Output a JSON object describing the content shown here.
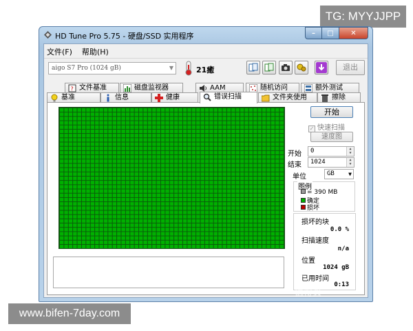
{
  "overlay": {
    "tg_label": "TG: MYYJJPP",
    "site_label": "www.bifen-7day.com",
    "faint_mark": "值得买"
  },
  "window": {
    "title": "HD Tune Pro 5.75 - 硬盘/SSD 实用程序",
    "buttons": {
      "minimize": "–",
      "maximize": "□",
      "close": "✕"
    }
  },
  "menu": {
    "file": "文件(F)",
    "help": "帮助(H)"
  },
  "toolbar": {
    "drive": "aigo    S7 Pro (1024 gB)",
    "temperature": "21癒",
    "exit_label": "退出",
    "icons": [
      "copy-info-icon",
      "copy-screen-icon",
      "camera-icon",
      "options-icon",
      "save-icon"
    ]
  },
  "tabs": {
    "row1": [
      "文件基准",
      "磁盘监视器",
      "AAM",
      "随机访问",
      "额外测试"
    ],
    "row2": [
      "基准",
      "信息",
      "健康",
      "错误扫描",
      "文件夹使用",
      "擦除"
    ],
    "active": "错误扫描"
  },
  "scan": {
    "start_label": "开始",
    "quick_scan_label": "快速扫描",
    "quick_scan_checked": true,
    "map_label": "速度图",
    "start_field_label": "开始",
    "start_value": "0",
    "end_field_label": "结束",
    "end_value": "1024",
    "unit_label": "单位",
    "unit_value": "GB",
    "legend_title": "图例",
    "legend": [
      {
        "label": "= 390 MB",
        "color": "#9a9a9a"
      },
      {
        "label": "确定",
        "color": "#00b000"
      },
      {
        "label": "损坏",
        "color": "#c00000"
      }
    ],
    "damaged_label": "损坏的块",
    "damaged_value": "0.0 %",
    "speed_label": "扫描速度",
    "speed_value": "n/a",
    "position_label": "位置",
    "position_value": "1024 gB",
    "elapsed_label": "已用时间",
    "elapsed_value": "0:13"
  }
}
